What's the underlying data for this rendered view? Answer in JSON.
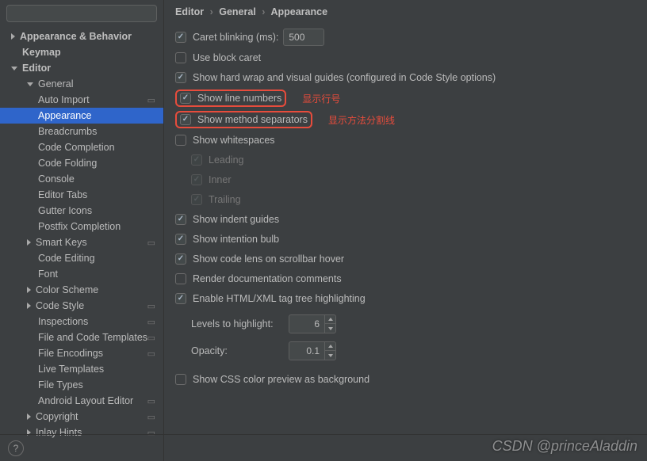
{
  "search": {
    "placeholder": ""
  },
  "tree": {
    "appearance_behavior": "Appearance & Behavior",
    "keymap": "Keymap",
    "editor": "Editor",
    "general": "General",
    "auto_import": "Auto Import",
    "appearance": "Appearance",
    "breadcrumbs": "Breadcrumbs",
    "code_completion": "Code Completion",
    "code_folding": "Code Folding",
    "console": "Console",
    "editor_tabs": "Editor Tabs",
    "gutter_icons": "Gutter Icons",
    "postfix_completion": "Postfix Completion",
    "smart_keys": "Smart Keys",
    "code_editing": "Code Editing",
    "font": "Font",
    "color_scheme": "Color Scheme",
    "code_style": "Code Style",
    "inspections": "Inspections",
    "file_code_templates": "File and Code Templates",
    "file_encodings": "File Encodings",
    "live_templates": "Live Templates",
    "file_types": "File Types",
    "android_layout": "Android Layout Editor",
    "copyright": "Copyright",
    "inlay_hints": "Inlay Hints"
  },
  "crumb": {
    "a": "Editor",
    "b": "General",
    "c": "Appearance"
  },
  "opts": {
    "caret_blink": "Caret blinking (ms):",
    "caret_blink_val": "500",
    "block_caret": "Use block caret",
    "hard_wrap": "Show hard wrap and visual guides (configured in Code Style options)",
    "line_numbers": "Show line numbers",
    "line_numbers_note": "显示行号",
    "method_sep": "Show method separators",
    "method_sep_note": "显示方法分割线",
    "whitespaces": "Show whitespaces",
    "leading": "Leading",
    "inner": "Inner",
    "trailing": "Trailing",
    "indent_guides": "Show indent guides",
    "intention_bulb": "Show intention bulb",
    "code_lens": "Show code lens on scrollbar hover",
    "render_doc": "Render documentation comments",
    "tag_tree": "Enable HTML/XML tag tree highlighting",
    "levels_lbl": "Levels to highlight:",
    "levels_val": "6",
    "opacity_lbl": "Opacity:",
    "opacity_val": "0.1",
    "css_preview": "Show CSS color preview as background"
  },
  "watermark": "CSDN @princeAladdin"
}
